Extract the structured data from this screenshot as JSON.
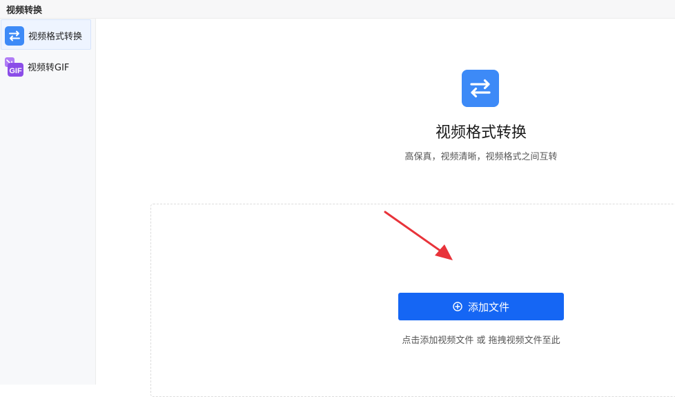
{
  "window": {
    "title": "视频转换"
  },
  "sidebar": {
    "items": [
      {
        "label": "视频格式转换",
        "icon": "swap-arrows-icon",
        "active": true
      },
      {
        "label": "视频转GIF",
        "icon": "gif-icon",
        "active": false
      }
    ]
  },
  "main": {
    "icon": "swap-arrows-icon",
    "title": "视频格式转换",
    "subtitle": "高保真，视频清晰，视频格式之间互转",
    "add_button_label": "添加文件",
    "hint": "点击添加视频文件 或 拖拽视频文件至此"
  },
  "colors": {
    "accent": "#1566f4",
    "icon_blue": "#3d8af7",
    "gif_purple": "#8b4de8",
    "arrow_red": "#e8333a"
  }
}
